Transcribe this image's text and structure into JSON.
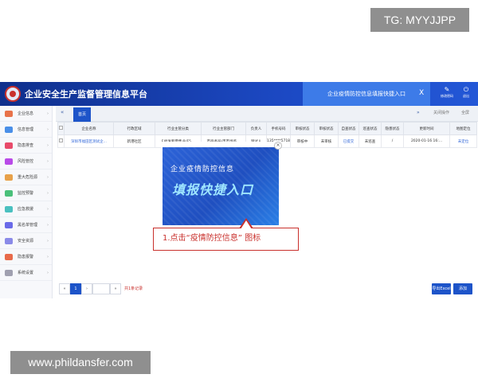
{
  "watermark_top": "TG: MYYJJPP",
  "watermark_bottom": "www.phildansfer.com",
  "header": {
    "title": "企业安全生产监督管理信息平台",
    "active_tab": "企业疫情防控信息填报快捷入口",
    "tab_close": "X",
    "icons": [
      {
        "icon": "edit-password-icon",
        "label": "修改密码",
        "glyph": "✎"
      },
      {
        "icon": "logout-icon",
        "label": "退出",
        "glyph": "⏻"
      }
    ]
  },
  "sidebar": {
    "items": [
      {
        "label": "企业信息",
        "icon": "company-icon",
        "color": "#e8734a"
      },
      {
        "label": "信息管理",
        "icon": "info-icon",
        "color": "#4a8fe8"
      },
      {
        "label": "隐患排查",
        "icon": "hazard-icon",
        "color": "#e84a6a"
      },
      {
        "label": "风险管控",
        "icon": "risk-icon",
        "color": "#b94ae8"
      },
      {
        "label": "重大危险源",
        "icon": "danger-source-icon",
        "color": "#e8a14a"
      },
      {
        "label": "监控预警",
        "icon": "monitor-icon",
        "color": "#4ac07a"
      },
      {
        "label": "应急救援",
        "icon": "rescue-icon",
        "color": "#4ac0c0"
      },
      {
        "label": "黑名单管理",
        "icon": "blacklist-icon",
        "color": "#6a6ae8"
      },
      {
        "label": "安全资源",
        "icon": "resource-icon",
        "color": "#8a8ae8"
      },
      {
        "label": "隐患报警",
        "icon": "alarm-icon",
        "color": "#e86a4a"
      },
      {
        "label": "系统设置",
        "icon": "settings-icon",
        "color": "#a0a0b0"
      }
    ]
  },
  "tabs": {
    "back": "«",
    "home": "首页",
    "forward": "»",
    "close_ops": "关闭操作",
    "fullscreen": "全屏"
  },
  "table": {
    "columns": [
      "",
      "企业名称",
      "行政区域",
      "行业主管分类",
      "行业主管部门",
      "负责人",
      "手机号码",
      "审核状态",
      "审核状态",
      "自查状态",
      "巡查状态",
      "隐患状态",
      "更新时间",
      "地图定位"
    ],
    "rows": [
      [
        "",
        "深圳市福田区测试企...",
        "新港社区",
        "F.批发和零售业/F5...",
        "市商务局/市市场监...",
        "测试人",
        "135****5718",
        "审核中",
        "未审核",
        "已提交",
        "未巡查",
        "/",
        "2020-01-16 16:...",
        "未定位"
      ]
    ]
  },
  "popup": {
    "subtitle": "企业疫情防控信息",
    "title": "填报快捷入口",
    "close": "×"
  },
  "callout": "1.点击“疫情防控信息” 图标",
  "pager": {
    "first": "«",
    "page": "1",
    "next": "›",
    "last": "»",
    "total": "共1条记录"
  },
  "footer_buttons": {
    "export": "导出Excel",
    "add": "添加"
  }
}
